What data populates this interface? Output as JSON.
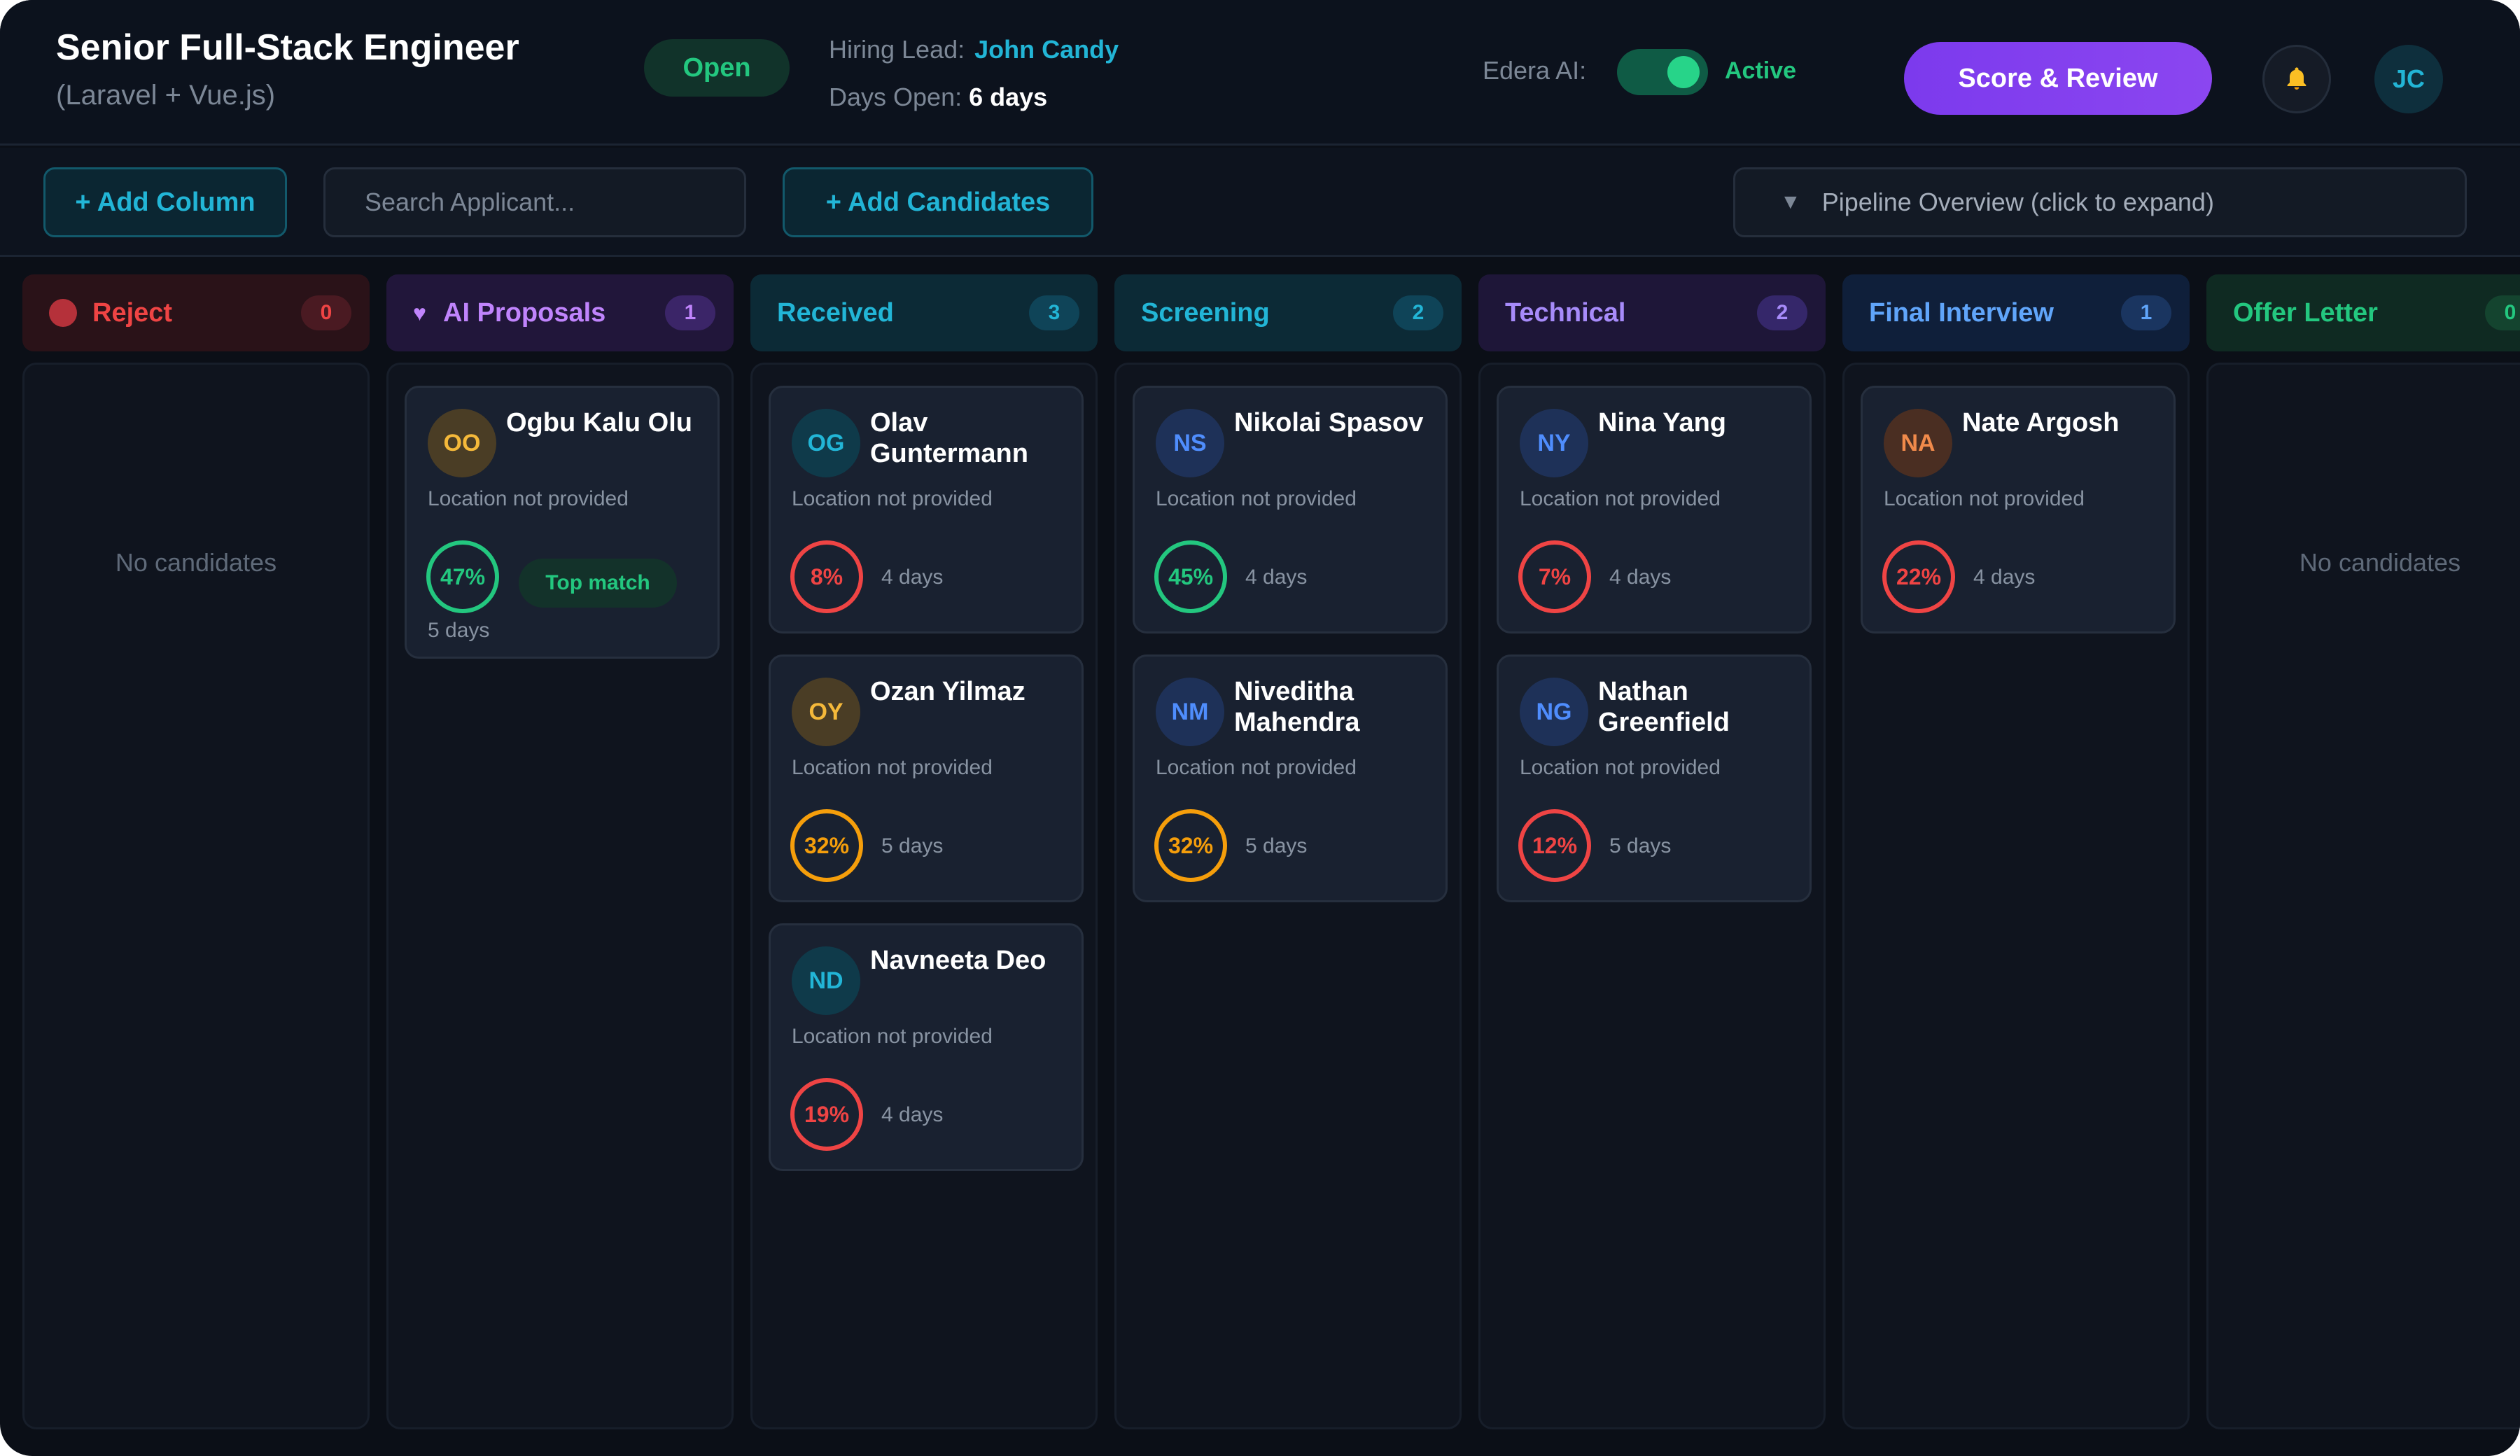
{
  "header": {
    "title": "Senior Full-Stack Engineer",
    "subtitle": "(Laravel + Vue.js)",
    "status": "Open",
    "hiring_lead_label": "Hiring Lead:",
    "hiring_lead_name": "John Candy",
    "days_open_label": "Days Open:",
    "days_open_value": "6 days",
    "ai_label": "Edera AI:",
    "ai_status": "Active",
    "ai_toggle_on": true,
    "score_button": "Score & Review",
    "bell_icon": "bell-icon",
    "user_initials": "JC"
  },
  "toolbar": {
    "add_column": "+ Add Column",
    "search_placeholder": "Search Applicant...",
    "add_candidates": "+ Add Candidates",
    "pipeline_arrow": "▼",
    "pipeline_label": "Pipeline Overview (click to expand)"
  },
  "columns": [
    {
      "title": "Reject",
      "count": "0",
      "icon": "dot-icon",
      "empty_text": "No candidates",
      "cards": []
    },
    {
      "title": "AI Proposals",
      "count": "1",
      "icon": "heart-icon",
      "icon_glyph": "♥",
      "cards": [
        {
          "initials": "OO",
          "name": "Ogbu Kalu Olu",
          "location": "Location not provided",
          "score": "47%",
          "days": "5 days",
          "badge": "Top match"
        }
      ]
    },
    {
      "title": "Received",
      "count": "3",
      "cards": [
        {
          "initials": "OG",
          "name": "Olav Guntermann",
          "location": "Location not provided",
          "score": "8%",
          "days": "4 days"
        },
        {
          "initials": "OY",
          "name": "Ozan Yilmaz",
          "location": "Location not provided",
          "score": "32%",
          "days": "5 days"
        },
        {
          "initials": "ND",
          "name": "Navneeta Deo",
          "location": "Location not provided",
          "score": "19%",
          "days": "4 days"
        }
      ]
    },
    {
      "title": "Screening",
      "count": "2",
      "cards": [
        {
          "initials": "NS",
          "name": "Nikolai Spasov",
          "location": "Location not provided",
          "score": "45%",
          "days": "4 days"
        },
        {
          "initials": "NM",
          "name": "Niveditha Mahendra",
          "location": "Location not provided",
          "score": "32%",
          "days": "5 days"
        }
      ]
    },
    {
      "title": "Technical",
      "count": "2",
      "cards": [
        {
          "initials": "NY",
          "name": "Nina Yang",
          "location": "Location not provided",
          "score": "7%",
          "days": "4 days"
        },
        {
          "initials": "NG",
          "name": "Nathan Greenfield",
          "location": "Location not provided",
          "score": "12%",
          "days": "5 days"
        }
      ]
    },
    {
      "title": "Final Interview",
      "count": "1",
      "cards": [
        {
          "initials": "NA",
          "name": "Nate Argosh",
          "location": "Location not provided",
          "score": "22%",
          "days": "4 days"
        }
      ]
    },
    {
      "title": "Offer Letter",
      "count": "0",
      "empty_text": "No candidates",
      "cards": []
    }
  ],
  "colors": {
    "reject": "#ef4444",
    "ai_proposals": "#c084fc",
    "received": "#22b5d6",
    "screening": "#22b5d6",
    "technical": "#a78bfa",
    "final_interview": "#60a5fa",
    "offer_letter": "#23c77f",
    "score_high": "#23c77f",
    "score_mid": "#f59e0b",
    "score_low": "#ef4444"
  }
}
